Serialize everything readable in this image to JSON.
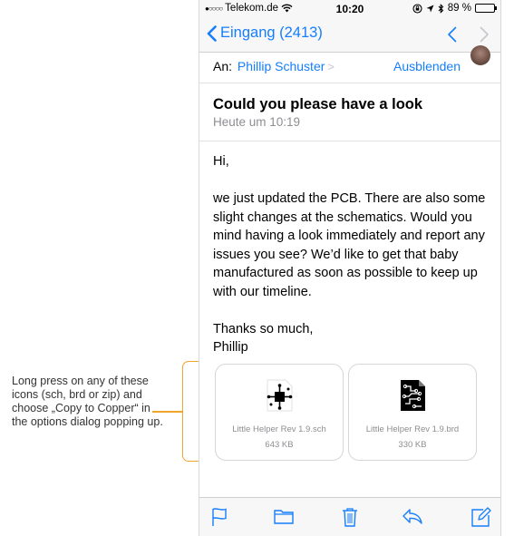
{
  "annotation": {
    "text": "Long press on any of these icons (sch, brd or zip) and choose „Copy to Copper“ in the options dialog popping up.",
    "accent_color": "#f0a52b"
  },
  "statusbar": {
    "carrier": "Telekom.de",
    "time": "10:20",
    "battery": "89 %"
  },
  "navbar": {
    "back_label": "Eingang (2413)",
    "accent_color": "#157efb"
  },
  "header": {
    "to_label": "An:",
    "recipient": "Phillip Schuster",
    "hide_label": "Ausblenden"
  },
  "message": {
    "subject": "Could you please have a look",
    "date": "Heute um 10:19",
    "greeting": "Hi,",
    "paragraph": "we just updated the PCB. There are also some slight changes at the schematics. Would you mind having a look immediately and report any issues you see? We’d like to get that baby manufactured as soon as possible to keep up with our timeline.",
    "closing": "Thanks so much,",
    "signature": "Phillip"
  },
  "attachments": [
    {
      "name": "Little Helper Rev 1.9.sch",
      "size": "643 KB",
      "icon": "schematic-file-icon"
    },
    {
      "name": "Little Helper Rev 1.9.brd",
      "size": "330 KB",
      "icon": "board-file-icon"
    }
  ],
  "toolbar": {
    "icons": [
      "flag-icon",
      "folder-icon",
      "trash-icon",
      "reply-icon",
      "compose-icon"
    ]
  }
}
